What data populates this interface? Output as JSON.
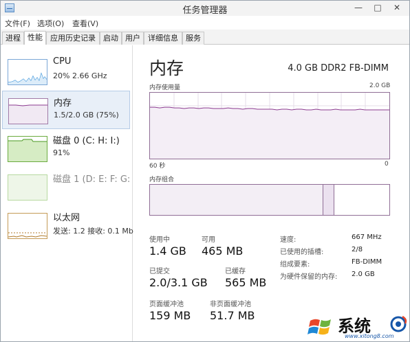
{
  "window": {
    "title": "任务管理器",
    "controls": {
      "minimize": "—",
      "maximize": "□",
      "close": "✕"
    }
  },
  "menubar": {
    "items": [
      "文件(F)",
      "选项(O)",
      "查看(V)"
    ]
  },
  "tabs": {
    "items": [
      "进程",
      "性能",
      "应用历史记录",
      "启动",
      "用户",
      "详细信息",
      "服务"
    ],
    "active": "性能"
  },
  "sidebar": {
    "items": [
      {
        "name": "CPU",
        "detail": "20% 2.66 GHz",
        "color": "#1f86d6"
      },
      {
        "name": "内存",
        "detail": "1.5/2.0 GB (75%)",
        "color": "#8b3a8f"
      },
      {
        "name": "磁盘 0 (C: H: I:)",
        "detail": "91%",
        "color": "#4a9a22"
      },
      {
        "name": "磁盘 1 (D: E: F: G:",
        "detail": "",
        "color": "#4a9a22"
      },
      {
        "name": "以太网",
        "detail": "发送: 1.2 接收: 0.1 Mb",
        "color": "#b07a2a"
      }
    ]
  },
  "memory": {
    "title": "内存",
    "spec": "4.0 GB DDR2 FB-DIMM",
    "usage_label": "内存使用量",
    "usage_max": "2.0 GB",
    "time_span": "60 秒",
    "time_end": "0",
    "composition_label": "内存组合",
    "stats": {
      "in_use_label": "使用中",
      "in_use": "1.4 GB",
      "available_label": "可用",
      "available": "465 MB",
      "committed_label": "已提交",
      "committed": "2.0/3.1 GB",
      "cached_label": "已缓存",
      "cached": "565 MB",
      "paged_label": "页面缓冲池",
      "paged": "159 MB",
      "nonpaged_label": "非页面缓冲池",
      "nonpaged": "51.7 MB"
    },
    "details": [
      {
        "label": "速度:",
        "value": "667 MHz"
      },
      {
        "label": "已使用的插槽:",
        "value": "2/8"
      },
      {
        "label": "组成要素:",
        "value": "FB-DIMM"
      },
      {
        "label": "为硬件保留的内存:",
        "value": "2.0 GB"
      }
    ],
    "usage_series": [
      0.78,
      0.78,
      0.77,
      0.78,
      0.78,
      0.77,
      0.77,
      0.76,
      0.77,
      0.77,
      0.76,
      0.77,
      0.77,
      0.76,
      0.76,
      0.76,
      0.77,
      0.76,
      0.76,
      0.75,
      0.76,
      0.76,
      0.75,
      0.75,
      0.75,
      0.75,
      0.74,
      0.75,
      0.75,
      0.74,
      0.75,
      0.75,
      0.74,
      0.74,
      0.75,
      0.74,
      0.74,
      0.74,
      0.75,
      0.74,
      0.74,
      0.74,
      0.74,
      0.75,
      0.74,
      0.74,
      0.74,
      0.74,
      0.74,
      0.74
    ],
    "composition": {
      "in_use_fraction": 0.725,
      "modified_fraction": 0.046
    }
  },
  "watermark": {
    "chars": "系统",
    "url": "www.xitong8.com"
  }
}
